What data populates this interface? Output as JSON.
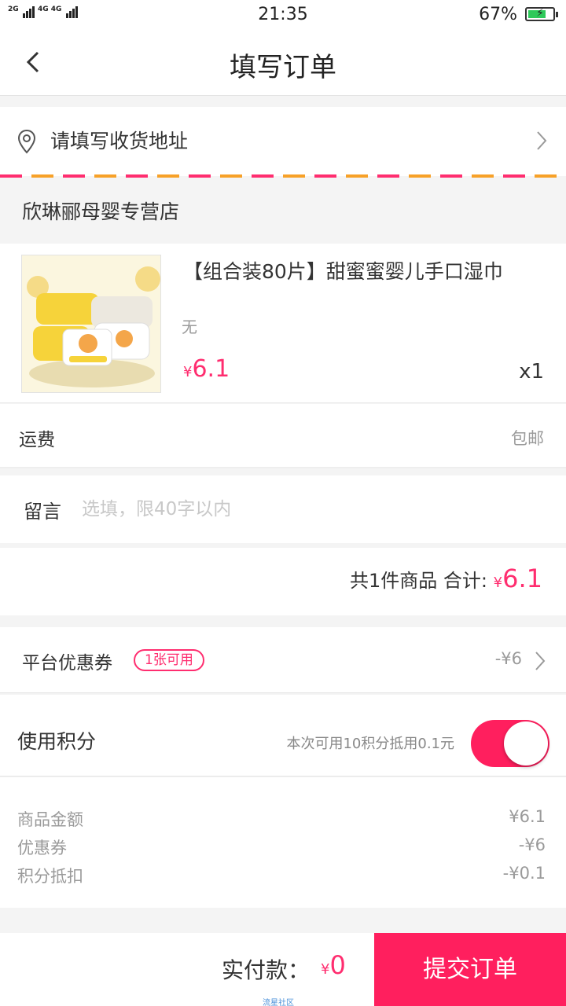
{
  "status_bar": {
    "signal_left": "2G",
    "signal_right": "4G 4G",
    "signal_sub": "2G",
    "time": "21:35",
    "battery_percent": "67%",
    "battery_level": 0.67,
    "charging": true
  },
  "header": {
    "title": "填写订单",
    "back_icon": "chevron-left-icon"
  },
  "address": {
    "label": "请填写收货地址",
    "icon": "location-pin-icon"
  },
  "store": {
    "name": "欣琳郦母婴专营店"
  },
  "product": {
    "name": "【组合装80片】甜蜜蜜婴儿手口湿巾",
    "spec": "无",
    "currency": "¥",
    "price": "6.1",
    "quantity": "x1"
  },
  "shipping": {
    "label": "运费",
    "value": "包邮"
  },
  "message": {
    "label": "留言",
    "placeholder": "选填，限40字以内"
  },
  "subtotal": {
    "prefix": "共1件商品 合计: ",
    "currency": "¥",
    "amount": "6.1"
  },
  "coupon": {
    "label": "平台优惠券",
    "badge": "1张可用",
    "value": "-¥6"
  },
  "points": {
    "label": "使用积分",
    "hint": "本次可用10积分抵用0.1元",
    "enabled": true
  },
  "summary": [
    {
      "key": "商品金额",
      "value": "¥6.1"
    },
    {
      "key": "优惠券",
      "value": "-¥6"
    },
    {
      "key": "积分抵扣",
      "value": "-¥0.1"
    }
  ],
  "bottom_bar": {
    "pay_label": "实付款：",
    "currency": "¥",
    "pay_amount": "0",
    "submit_label": "提交订单",
    "watermark": "流星社区"
  },
  "colors": {
    "accent": "#ff2d6f",
    "toggle_on": "#ff1f5e",
    "stripe_orange": "#f7a128"
  }
}
